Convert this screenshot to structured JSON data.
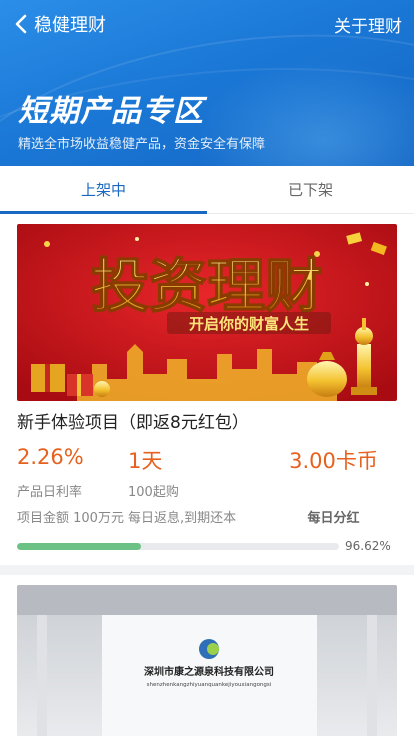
{
  "header": {
    "back_label": "稳健理财",
    "right_link": "关于理财"
  },
  "banner": {
    "title": "短期产品专区",
    "subtitle": "精选全市场收益稳健产品，资金安全有保障"
  },
  "tabs": [
    {
      "label": "上架中"
    },
    {
      "label": "已下架"
    }
  ],
  "products": [
    {
      "image": {
        "headline": "投资理财",
        "tagline": "开启你的财富人生"
      },
      "title": "新手体验项目（即返8元红包）",
      "rate_value": "2.26%",
      "rate_label": "产品日利率",
      "term_value": "1天",
      "term_label": "100起购",
      "amount_value": "3.00卡币",
      "total_line": "项目金额 100万元",
      "repay_line": "每日返息,到期还本",
      "repay_type": "每日分红",
      "progress": 0.9662,
      "progress_text": "96.62%"
    },
    {
      "image": {
        "company": "深圳市康之源泉科技有限公司",
        "company_en": "shenzhenkangzhiyuanquankejiyouxiangongsi"
      }
    }
  ],
  "colors": {
    "accent": "#1a68c2",
    "value_orange": "#e6611e",
    "progress_green": "#6cc184"
  }
}
